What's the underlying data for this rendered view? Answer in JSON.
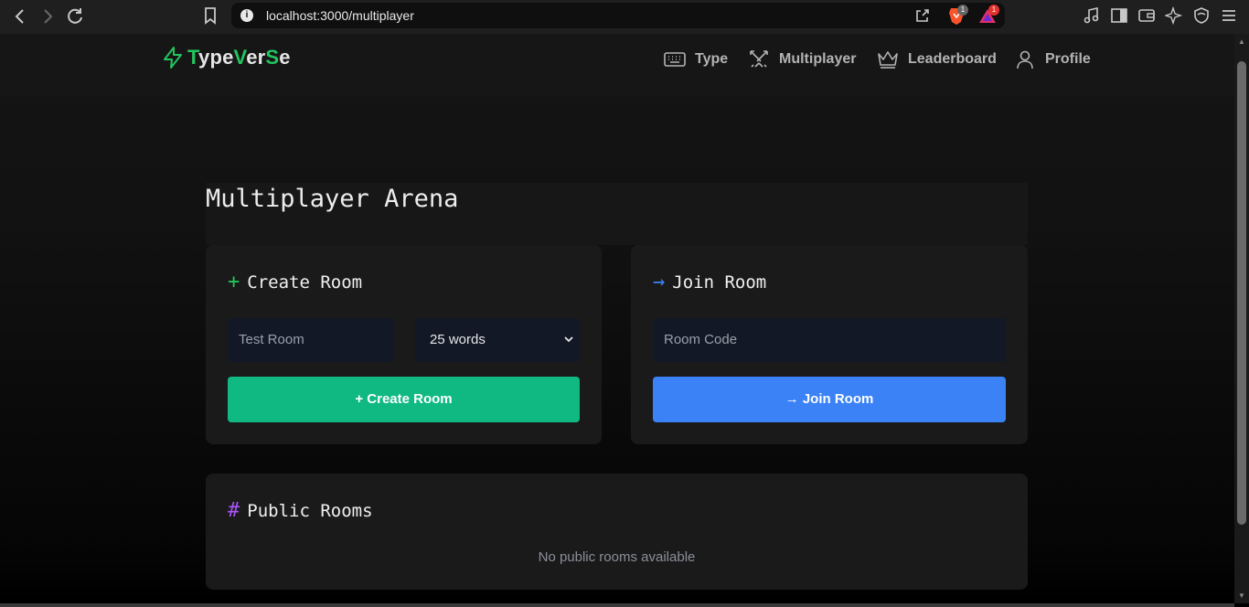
{
  "browser": {
    "url": "localhost:3000/multiplayer",
    "brave_badge": "1",
    "rewards_badge": "1"
  },
  "nav": {
    "logo_parts": [
      "T",
      "ype",
      "V",
      "er",
      "S",
      "e"
    ],
    "items": [
      {
        "label": "Type",
        "icon": "keyboard-icon"
      },
      {
        "label": "Multiplayer",
        "icon": "swords-icon"
      },
      {
        "label": "Leaderboard",
        "icon": "crown-icon"
      },
      {
        "label": "Profile",
        "icon": "user-icon"
      }
    ]
  },
  "main": {
    "title": "Multiplayer Arena",
    "create_room": {
      "symbol": "+",
      "title": "Create Room",
      "room_name_placeholder": "Test Room",
      "word_count_selected": "25 words",
      "button_label": "+ Create Room"
    },
    "join_room": {
      "symbol": "→",
      "title": "Join Room",
      "room_code_placeholder": "Room Code",
      "button_label": "→ Join Room"
    },
    "public_rooms": {
      "symbol": "#",
      "title": "Public Rooms",
      "empty_text": "No public rooms available"
    }
  },
  "colors": {
    "brand_green": "#22c55e",
    "create_button": "#10b981",
    "join_button": "#3b82f6",
    "public_symbol": "#a855f7"
  }
}
